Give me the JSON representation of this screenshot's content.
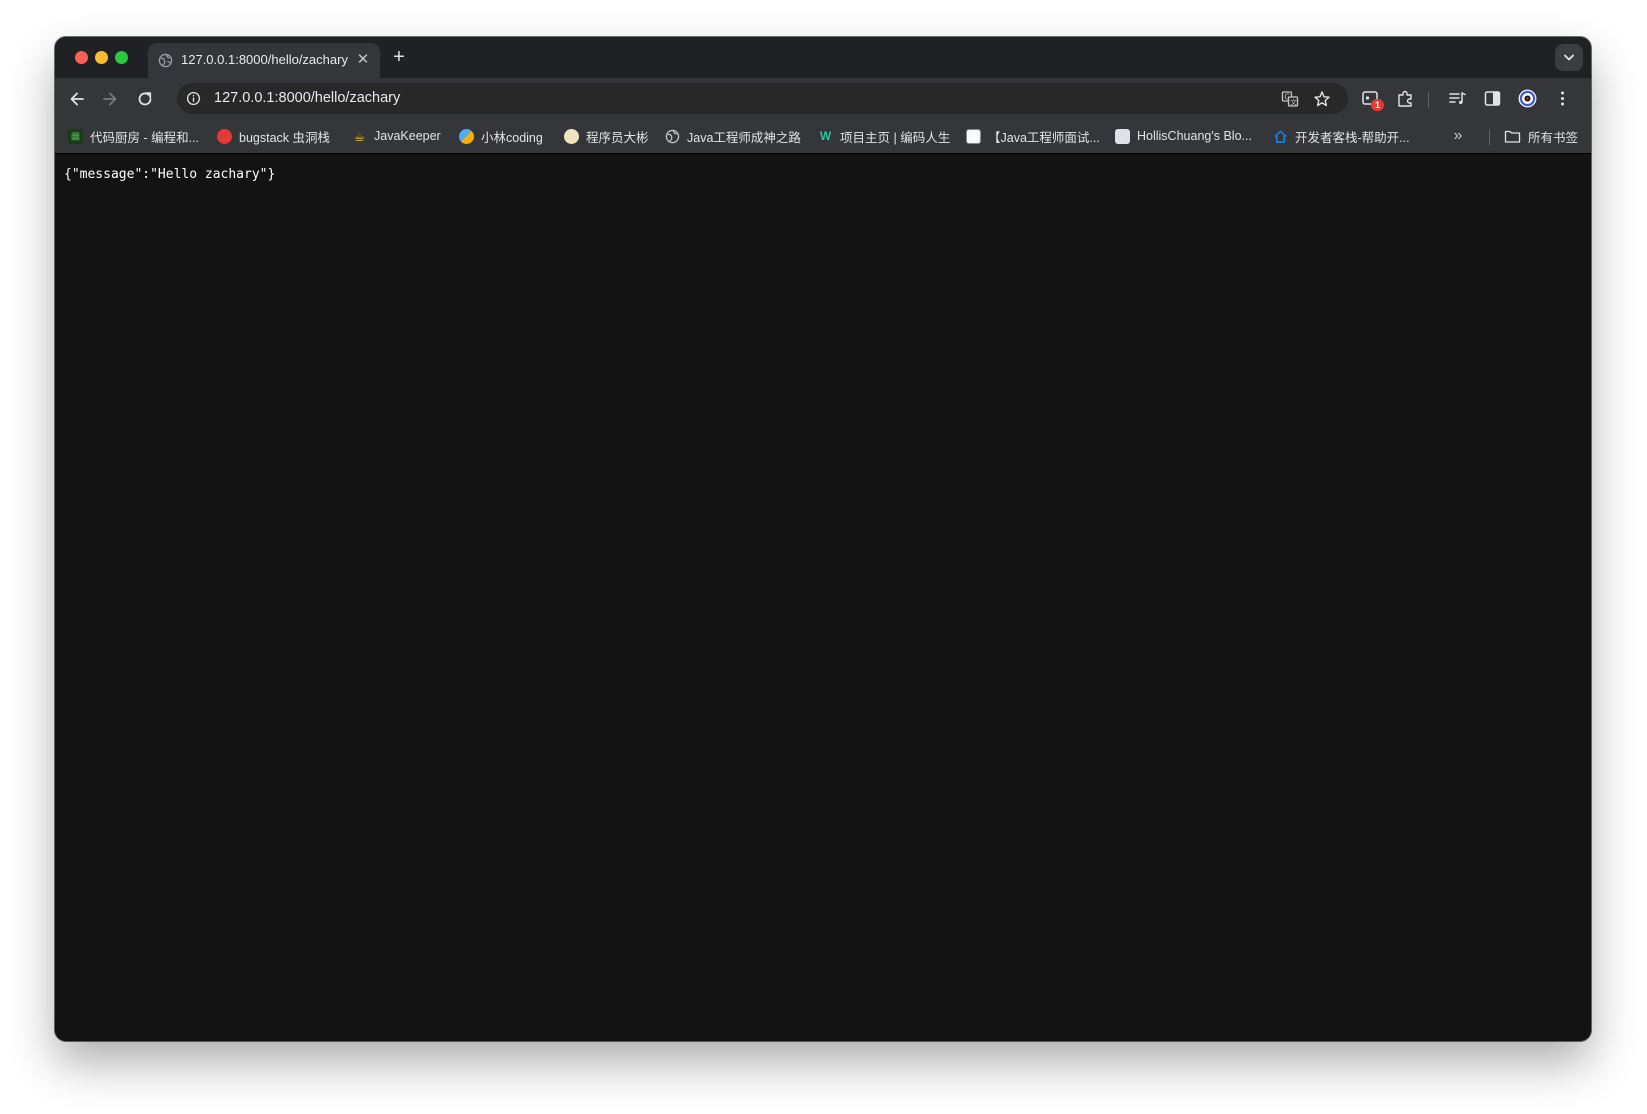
{
  "browser": {
    "tab": {
      "title": "127.0.0.1:8000/hello/zachary",
      "favicon": "globe-icon"
    },
    "address_bar": {
      "url": "127.0.0.1:8000/hello/zachary"
    },
    "extensions_badge": "1",
    "bookmarks": [
      {
        "label": "代码厨房 - 编程和...",
        "icon": "code-kitchen-icon"
      },
      {
        "label": "bugstack 虫洞栈",
        "icon": "bugstack-icon"
      },
      {
        "label": "JavaKeeper",
        "icon": "javakeeper-icon"
      },
      {
        "label": "小林coding",
        "icon": "xiaolin-icon"
      },
      {
        "label": "程序员大彬",
        "icon": "dabin-icon"
      },
      {
        "label": "Java工程师成神之路",
        "icon": "globe-icon"
      },
      {
        "label": "项目主页 | 编码人生",
        "icon": "w-logo-icon"
      },
      {
        "label": "【Java工程师面试...",
        "icon": "interview-icon"
      },
      {
        "label": "HollisChuang's Blo...",
        "icon": "hollis-icon"
      },
      {
        "label": "开发者客栈-帮助开...",
        "icon": "house-icon"
      }
    ],
    "all_bookmarks_label": "所有书签"
  },
  "page": {
    "body_text": "{\"message\":\"Hello zachary\"}"
  },
  "colors": {
    "frame": "#202124",
    "toolbar": "#35363a",
    "omnibox": "#282828",
    "page_background": "#131313",
    "text": "#ffffff"
  }
}
